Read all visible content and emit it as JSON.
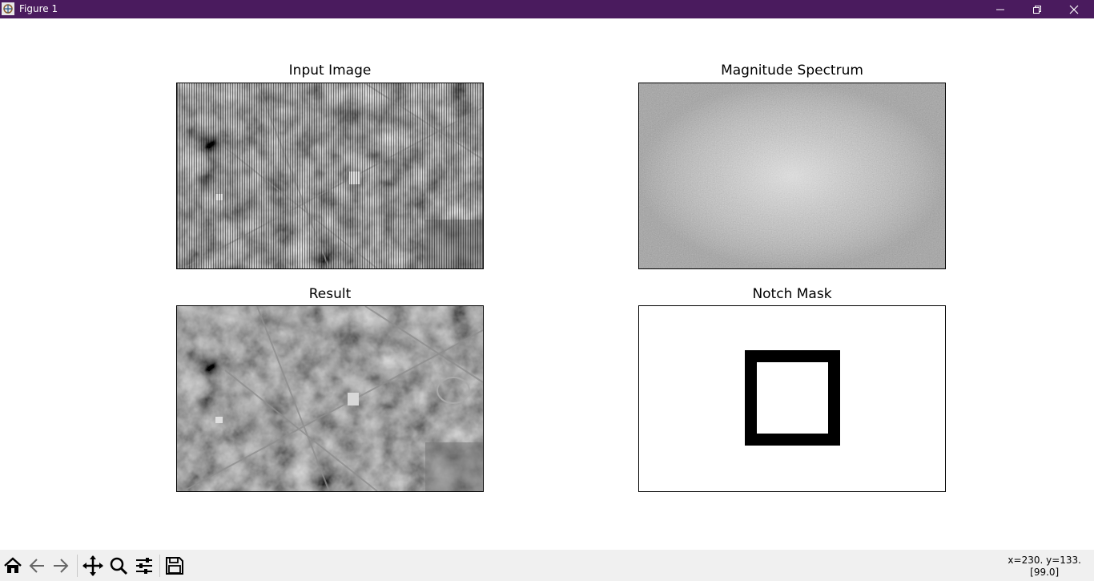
{
  "window": {
    "title": "Figure 1",
    "app_icon": "matplotlib-figure-icon",
    "controls": [
      "minimize-icon",
      "restore-icon",
      "close-icon"
    ],
    "titlebar_color": "#4a1b5e"
  },
  "axes": {
    "input": {
      "title": "Input Image",
      "content": "grayscale aerial photograph of a town with periodic vertical stripe noise"
    },
    "spectrum": {
      "title": "Magnitude Spectrum",
      "content": "gray noise-like spectrum, bright center"
    },
    "result": {
      "title": "Result",
      "content": "grayscale aerial photograph with stripe noise removed"
    },
    "mask": {
      "title": "Notch Mask",
      "content": "white field with a black square ring at the center"
    }
  },
  "toolbar": {
    "buttons": [
      "home-icon",
      "back-icon",
      "forward-icon",
      "pan-icon",
      "zoom-icon",
      "configure-subplots-icon",
      "save-icon"
    ]
  },
  "status": {
    "coords": "x=230. y=133.",
    "value": "[99.0]"
  }
}
